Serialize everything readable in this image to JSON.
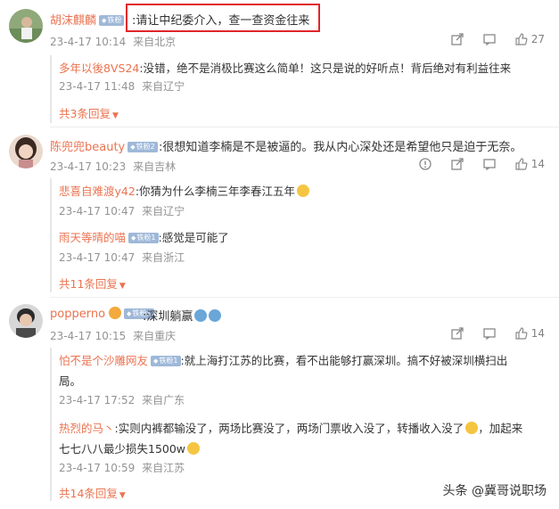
{
  "comments": [
    {
      "name": "胡沫麒麟",
      "badge": "铁粉",
      "text": ":请让中纪委介入，查一查资金往来",
      "time": "23-4-17 10:14",
      "location": "来自北京",
      "likes": "27",
      "replies": [
        {
          "name": "多年以後8VS24",
          "text": ":没错，绝不是消极比赛这么简单！这只是说的好听点！背后绝对有利益往来",
          "time": "23-4-17 11:48",
          "location": "来自辽宁"
        }
      ],
      "more": "共3条回复"
    },
    {
      "name": "陈兜兜beauty",
      "badge": "铁粉2",
      "text": ":很想知道李楠是不是被逼的。我从内心深处还是希望他只是迫于无奈。",
      "time": "23-4-17 10:23",
      "location": "来自吉林",
      "likes": "14",
      "replies": [
        {
          "name": "悲喜自难渡y42",
          "text": ":你猜为什么李楠三年李春江五年",
          "time": "23-4-17 10:47",
          "location": "来自辽宁"
        },
        {
          "name": "雨天等晴的喵",
          "badge": "铁粉1",
          "text": ":感觉是可能了",
          "time": "23-4-17 10:47",
          "location": "来自浙江"
        }
      ],
      "more": "共11条回复"
    },
    {
      "name": "popperno",
      "badge": "铁粉1",
      "text": ":深圳躺赢",
      "time": "23-4-17 10:15",
      "location": "来自重庆",
      "likes": "14",
      "replies": [
        {
          "name": "怕不是个沙雕网友",
          "badge": "铁粉1",
          "text": ":就上海打江苏的比赛，看不出能够打赢深圳。搞不好被深圳横扫出",
          "text2": "局。",
          "time": "23-4-17 17:52",
          "location": "来自广东"
        },
        {
          "name": "热烈的马丶",
          "text": ":实则内裤都输没了，两场比赛没了，两场门票收入没了，转播收入没了",
          "text2": "七七八八最少损失1500w",
          "time": "23-4-17 10:59",
          "location": "来自江苏",
          "extra": "，加起来"
        }
      ],
      "more": "共14条回复"
    }
  ],
  "watermark": "头条 @冀哥说职场",
  "colors": {
    "name": "#eb7350",
    "meta": "#939393",
    "highlight": "#e0262a",
    "badge": "#9fb8d8"
  }
}
